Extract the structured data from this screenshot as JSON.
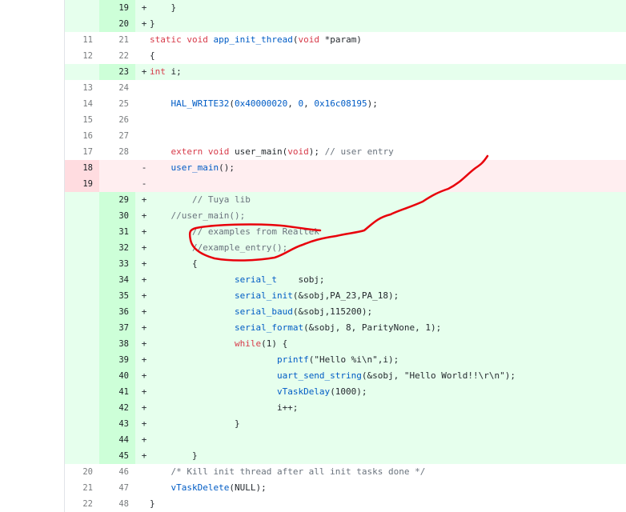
{
  "lines": [
    {
      "type": "add",
      "old": "",
      "new": "19",
      "marker": "+",
      "code": [
        {
          "t": "    }",
          "c": "plain"
        }
      ]
    },
    {
      "type": "add",
      "old": "",
      "new": "20",
      "marker": "+",
      "code": [
        {
          "t": "}",
          "c": "plain"
        }
      ]
    },
    {
      "type": "ctx",
      "old": "11",
      "new": "21",
      "marker": "",
      "code": [
        {
          "t": "static void ",
          "c": "k"
        },
        {
          "t": "app_init_thread",
          "c": "f"
        },
        {
          "t": "(",
          "c": "plain"
        },
        {
          "t": "void",
          "c": "k"
        },
        {
          "t": " *param)",
          "c": "plain"
        }
      ]
    },
    {
      "type": "ctx",
      "old": "12",
      "new": "22",
      "marker": "",
      "code": [
        {
          "t": "{",
          "c": "plain"
        }
      ]
    },
    {
      "type": "add",
      "old": "",
      "new": "23",
      "marker": "+",
      "code": [
        {
          "t": "int",
          "c": "k"
        },
        {
          "t": " i;",
          "c": "plain"
        }
      ]
    },
    {
      "type": "ctx",
      "old": "13",
      "new": "24",
      "marker": "",
      "code": [
        {
          "t": "",
          "c": "plain"
        }
      ]
    },
    {
      "type": "ctx",
      "old": "14",
      "new": "25",
      "marker": "",
      "code": [
        {
          "t": "    ",
          "c": "plain"
        },
        {
          "t": "HAL_WRITE32",
          "c": "f"
        },
        {
          "t": "(",
          "c": "plain"
        },
        {
          "t": "0x40000020",
          "c": "n"
        },
        {
          "t": ", ",
          "c": "plain"
        },
        {
          "t": "0",
          "c": "n"
        },
        {
          "t": ", ",
          "c": "plain"
        },
        {
          "t": "0x16c08195",
          "c": "n"
        },
        {
          "t": ");",
          "c": "plain"
        }
      ]
    },
    {
      "type": "ctx",
      "old": "15",
      "new": "26",
      "marker": "",
      "code": [
        {
          "t": "",
          "c": "plain"
        }
      ]
    },
    {
      "type": "ctx",
      "old": "16",
      "new": "27",
      "marker": "",
      "code": [
        {
          "t": "",
          "c": "plain"
        }
      ]
    },
    {
      "type": "ctx",
      "old": "17",
      "new": "28",
      "marker": "",
      "code": [
        {
          "t": "    ",
          "c": "plain"
        },
        {
          "t": "extern void ",
          "c": "k"
        },
        {
          "t": "user_main",
          "c": "plain"
        },
        {
          "t": "(",
          "c": "plain"
        },
        {
          "t": "void",
          "c": "k"
        },
        {
          "t": "); ",
          "c": "plain"
        },
        {
          "t": "// user entry",
          "c": "c"
        }
      ]
    },
    {
      "type": "del",
      "old": "18",
      "new": "",
      "marker": "-",
      "code": [
        {
          "t": "    ",
          "c": "plain"
        },
        {
          "t": "user_main",
          "c": "f"
        },
        {
          "t": "();",
          "c": "plain"
        }
      ]
    },
    {
      "type": "del",
      "old": "19",
      "new": "",
      "marker": "-",
      "code": [
        {
          "t": "",
          "c": "plain"
        }
      ]
    },
    {
      "type": "add",
      "old": "",
      "new": "29",
      "marker": "+",
      "code": [
        {
          "t": "        ",
          "c": "plain"
        },
        {
          "t": "// Tuya lib",
          "c": "c"
        }
      ]
    },
    {
      "type": "add",
      "old": "",
      "new": "30",
      "marker": "+",
      "code": [
        {
          "t": "    ",
          "c": "plain"
        },
        {
          "t": "//user_main();",
          "c": "c"
        }
      ]
    },
    {
      "type": "add",
      "old": "",
      "new": "31",
      "marker": "+",
      "code": [
        {
          "t": "        ",
          "c": "plain"
        },
        {
          "t": "// examples from Realtek",
          "c": "c"
        }
      ]
    },
    {
      "type": "add",
      "old": "",
      "new": "32",
      "marker": "+",
      "code": [
        {
          "t": "        ",
          "c": "plain"
        },
        {
          "t": "//example_entry();",
          "c": "c"
        }
      ]
    },
    {
      "type": "add",
      "old": "",
      "new": "33",
      "marker": "+",
      "code": [
        {
          "t": "        {",
          "c": "plain"
        }
      ]
    },
    {
      "type": "add",
      "old": "",
      "new": "34",
      "marker": "+",
      "code": [
        {
          "t": "                ",
          "c": "plain"
        },
        {
          "t": "serial_t",
          "c": "f"
        },
        {
          "t": "    sobj;",
          "c": "plain"
        }
      ]
    },
    {
      "type": "add",
      "old": "",
      "new": "35",
      "marker": "+",
      "code": [
        {
          "t": "                ",
          "c": "plain"
        },
        {
          "t": "serial_init",
          "c": "f"
        },
        {
          "t": "(&sobj,PA_23,PA_18);",
          "c": "plain"
        }
      ]
    },
    {
      "type": "add",
      "old": "",
      "new": "36",
      "marker": "+",
      "code": [
        {
          "t": "                ",
          "c": "plain"
        },
        {
          "t": "serial_baud",
          "c": "f"
        },
        {
          "t": "(&sobj,115200);",
          "c": "plain"
        }
      ]
    },
    {
      "type": "add",
      "old": "",
      "new": "37",
      "marker": "+",
      "code": [
        {
          "t": "                ",
          "c": "plain"
        },
        {
          "t": "serial_format",
          "c": "f"
        },
        {
          "t": "(&sobj, 8, ParityNone, 1);",
          "c": "plain"
        }
      ]
    },
    {
      "type": "add",
      "old": "",
      "new": "38",
      "marker": "+",
      "code": [
        {
          "t": "                ",
          "c": "plain"
        },
        {
          "t": "while",
          "c": "k"
        },
        {
          "t": "(1) {",
          "c": "plain"
        }
      ]
    },
    {
      "type": "add",
      "old": "",
      "new": "39",
      "marker": "+",
      "code": [
        {
          "t": "                        ",
          "c": "plain"
        },
        {
          "t": "printf",
          "c": "f"
        },
        {
          "t": "(\"Hello %i\\n\",i);",
          "c": "plain"
        }
      ]
    },
    {
      "type": "add",
      "old": "",
      "new": "40",
      "marker": "+",
      "code": [
        {
          "t": "                        ",
          "c": "plain"
        },
        {
          "t": "uart_send_string",
          "c": "f"
        },
        {
          "t": "(&sobj, \"Hello World!!\\r\\n\");",
          "c": "plain"
        }
      ]
    },
    {
      "type": "add",
      "old": "",
      "new": "41",
      "marker": "+",
      "code": [
        {
          "t": "                        ",
          "c": "plain"
        },
        {
          "t": "vTaskDelay",
          "c": "f"
        },
        {
          "t": "(1000);",
          "c": "plain"
        }
      ]
    },
    {
      "type": "add",
      "old": "",
      "new": "42",
      "marker": "+",
      "code": [
        {
          "t": "                        i++;",
          "c": "plain"
        }
      ]
    },
    {
      "type": "add",
      "old": "",
      "new": "43",
      "marker": "+",
      "code": [
        {
          "t": "                }",
          "c": "plain"
        }
      ]
    },
    {
      "type": "add",
      "old": "",
      "new": "44",
      "marker": "+",
      "code": [
        {
          "t": "",
          "c": "plain"
        }
      ]
    },
    {
      "type": "add",
      "old": "",
      "new": "45",
      "marker": "+",
      "code": [
        {
          "t": "        }",
          "c": "plain"
        }
      ]
    },
    {
      "type": "ctx",
      "old": "20",
      "new": "46",
      "marker": "",
      "code": [
        {
          "t": "    ",
          "c": "plain"
        },
        {
          "t": "/* Kill init thread after all init tasks done */",
          "c": "c"
        }
      ]
    },
    {
      "type": "ctx",
      "old": "21",
      "new": "47",
      "marker": "",
      "code": [
        {
          "t": "    ",
          "c": "plain"
        },
        {
          "t": "vTaskDelete",
          "c": "f"
        },
        {
          "t": "(NULL);",
          "c": "plain"
        }
      ]
    },
    {
      "type": "ctx",
      "old": "22",
      "new": "48",
      "marker": "",
      "code": [
        {
          "t": "}",
          "c": "plain"
        }
      ]
    }
  ],
  "colors": {
    "added_bg": "#e6ffed",
    "deleted_bg": "#ffeef0",
    "annotation": "#e8000b"
  }
}
